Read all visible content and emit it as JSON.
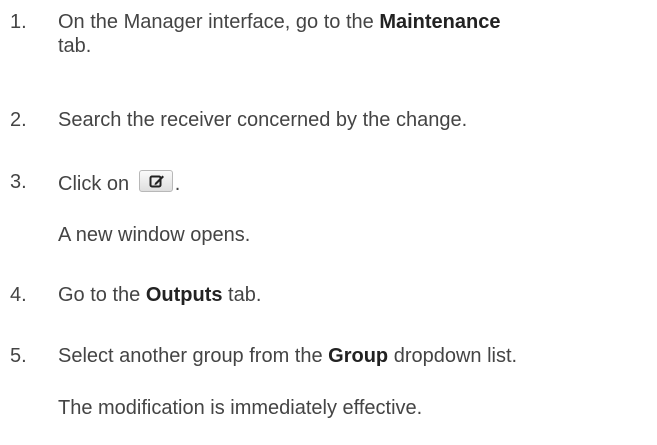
{
  "steps": [
    {
      "num": "1.",
      "pre": "On the Manager interface, go to the ",
      "bold": "Maintenance",
      "post_line2": "tab."
    },
    {
      "num": "2.",
      "text": "Search the receiver concerned by the change."
    },
    {
      "num": "3.",
      "pre": "Click on ",
      "icon": "edit-icon",
      "post": ".",
      "note": "A new window opens."
    },
    {
      "num": "4.",
      "pre": "Go to the ",
      "bold": "Outputs",
      "post": " tab."
    },
    {
      "num": "5.",
      "pre": "Select another group from the ",
      "bold": "Group",
      "post": " dropdown list.",
      "note": "The modification is immediately effective."
    }
  ]
}
